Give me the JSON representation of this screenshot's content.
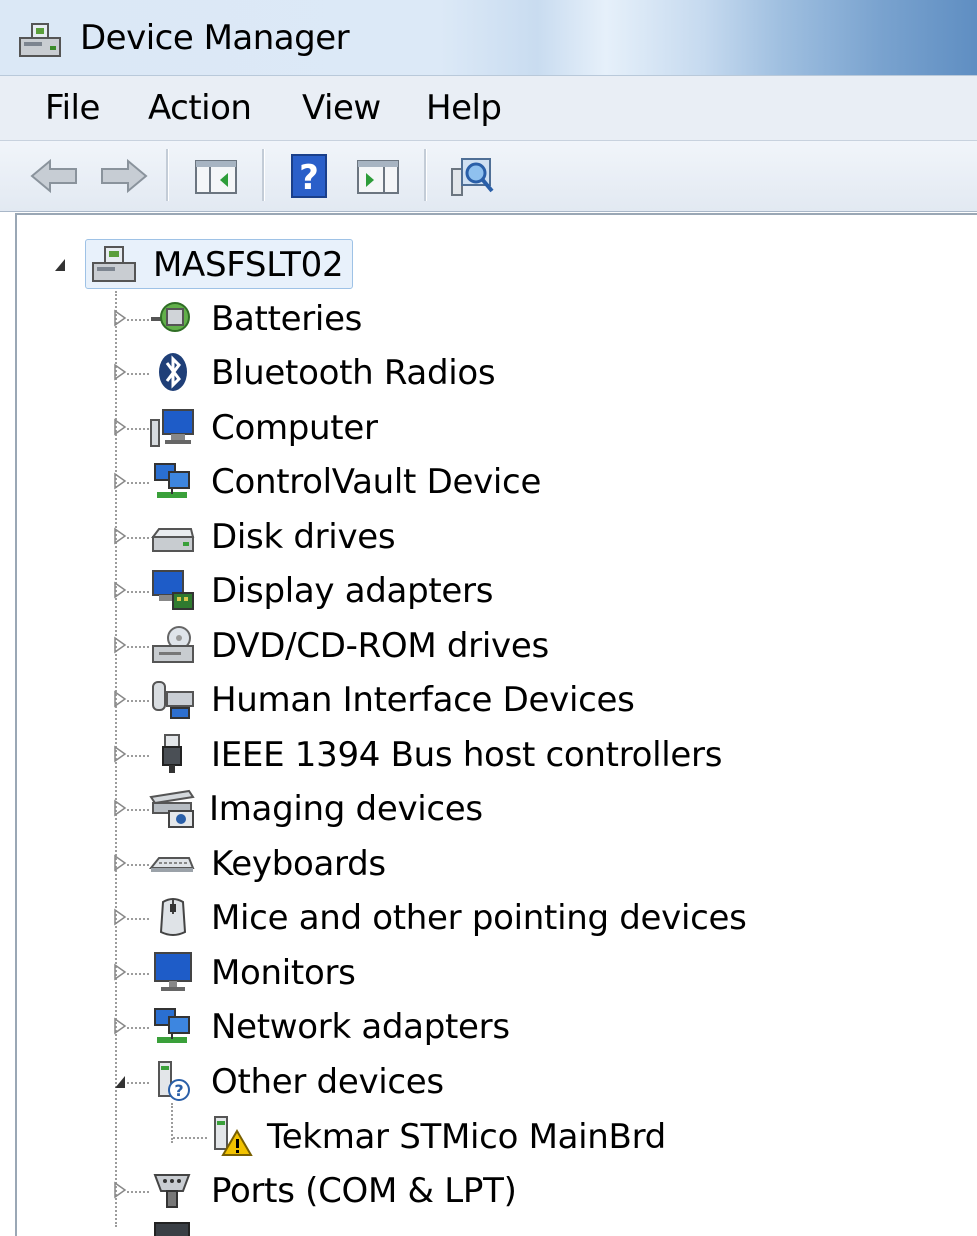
{
  "window": {
    "title": "Device Manager"
  },
  "menu": {
    "items": [
      "File",
      "Action",
      "View",
      "Help"
    ]
  },
  "toolbar": {
    "buttons": [
      "back-arrow-icon",
      "forward-arrow-icon",
      "show-hide-console-tree-icon",
      "help-icon",
      "show-hide-action-pane-icon",
      "scan-hardware-icon"
    ]
  },
  "tree": {
    "root": "MASFSLT02",
    "categories": [
      "Batteries",
      "Bluetooth Radios",
      "Computer",
      "ControlVault Device",
      "Disk drives",
      "Display adapters",
      "DVD/CD-ROM drives",
      "Human Interface Devices",
      "IEEE 1394 Bus host controllers",
      "Imaging devices",
      "Keyboards",
      "Mice and other pointing devices",
      "Monitors",
      "Network adapters",
      "Other devices",
      "Ports (COM & LPT)"
    ],
    "other_devices_children": [
      "Tekmar STMico MainBrd"
    ]
  }
}
